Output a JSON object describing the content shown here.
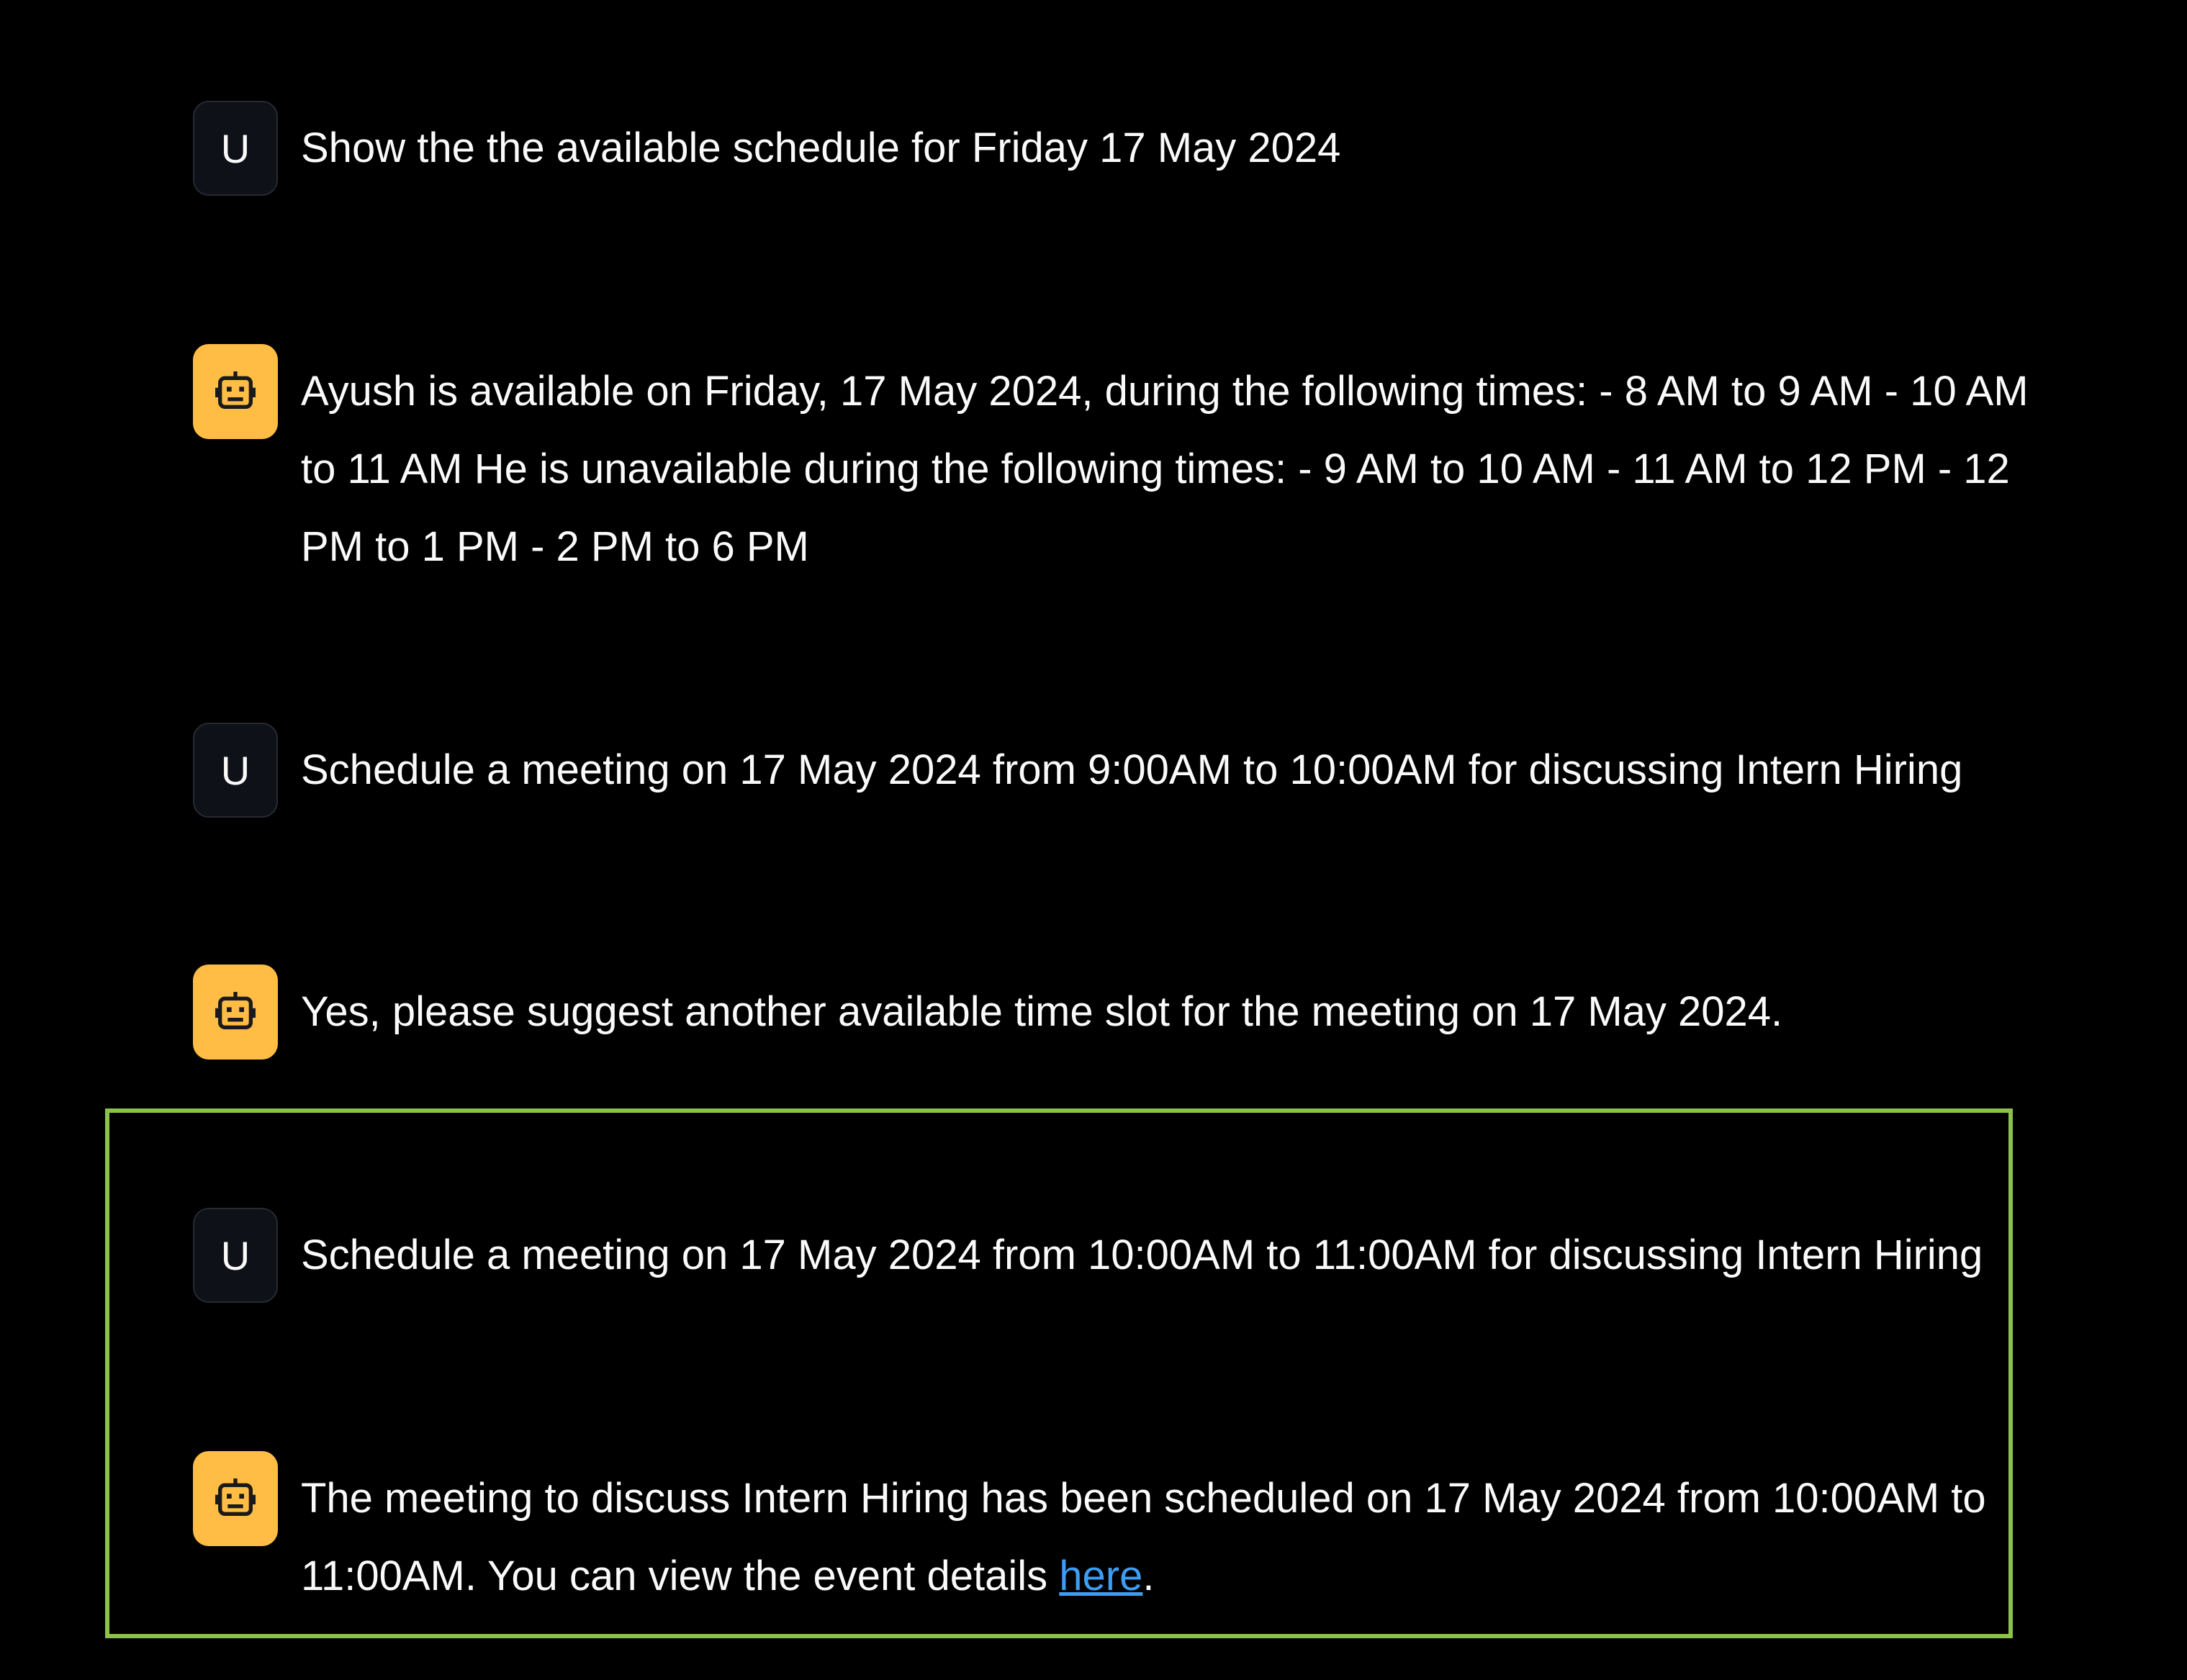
{
  "colors": {
    "background": "#000000",
    "user_avatar_bg": "#0e1117",
    "bot_avatar_bg": "#ffbd45",
    "link": "#3d9df3",
    "highlight_border": "#8bc34a"
  },
  "messages": [
    {
      "role": "user",
      "avatar_icon": "U",
      "text": "Show the the available schedule for Friday 17 May 2024"
    },
    {
      "role": "assistant",
      "avatar_icon": "robot-icon",
      "text": "Ayush is available on Friday, 17 May 2024, during the following times: - 8 AM to 9 AM - 10 AM to 11 AM He is unavailable during the following times: - 9 AM to 10 AM - 11 AM to 12 PM - 12 PM to 1 PM - 2 PM to 6 PM"
    },
    {
      "role": "user",
      "avatar_icon": "U",
      "text": "Schedule a meeting on 17 May 2024 from 9:00AM to 10:00AM for discussing Intern Hiring"
    },
    {
      "role": "assistant",
      "avatar_icon": "robot-icon",
      "text": "Yes, please suggest another available time slot for the meeting on 17 May 2024."
    },
    {
      "role": "user",
      "avatar_icon": "U",
      "text": "Schedule a meeting on 17 May 2024 from 10:00AM to 11:00AM for discussing Intern Hiring"
    },
    {
      "role": "assistant",
      "avatar_icon": "robot-icon",
      "text_before_link": "The meeting to discuss Intern Hiring has been scheduled on 17 May 2024 from 10:00AM to 11:00AM. You can view the event details ",
      "link_text": "here",
      "text_after_link": "."
    }
  ]
}
